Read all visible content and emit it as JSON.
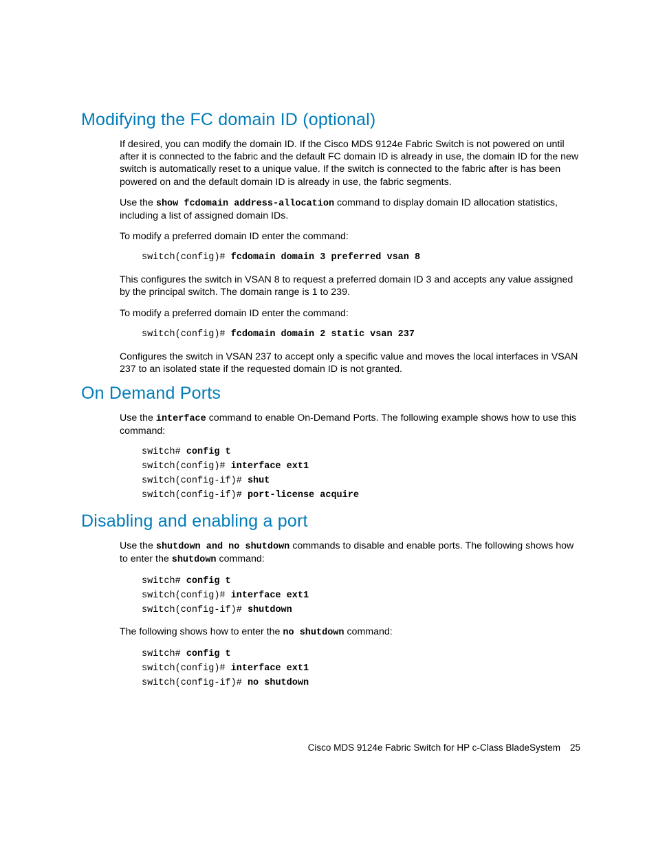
{
  "sections": {
    "s1": {
      "title": "Modifying the FC domain ID (optional)",
      "p1": "If desired, you can modify the domain ID. If the Cisco MDS 9124e Fabric Switch is not powered on until after it is connected to the fabric and the default FC domain ID is already in use, the domain ID for the new switch is automatically reset to a unique value. If the switch is connected to the fabric after is has been powered on and the default domain ID is already in use, the fabric segments.",
      "p2a": "Use the ",
      "p2cmd": "show fcdomain address-allocation",
      "p2b": " command to display domain ID allocation statistics, including a list of assigned domain IDs.",
      "p3": "To modify a preferred domain ID enter the command:",
      "code1_prompt": "switch(config)# ",
      "code1_cmd": "fcdomain domain 3 preferred vsan 8",
      "p4": "This configures the switch in VSAN 8 to request a preferred domain ID 3 and accepts any value assigned by the principal switch. The domain range is 1 to 239.",
      "p5": "To modify a preferred domain ID enter the command:",
      "code2_prompt": "switch(config)# ",
      "code2_cmd": "fcdomain domain 2 static vsan 237",
      "p6": "Configures the switch in VSAN 237 to accept only a specific value and moves the local interfaces in VSAN 237 to an isolated state if the requested domain ID is not granted."
    },
    "s2": {
      "title": "On Demand Ports",
      "p1a": "Use the ",
      "p1cmd": "interface",
      "p1b": " command to enable On-Demand Ports. The following example shows how to use this command:",
      "code_l1p": "switch# ",
      "code_l1c": "config t",
      "code_l2p": "switch(config)# ",
      "code_l2c": "interface ext1",
      "code_l3p": "switch(config-if)# ",
      "code_l3c": "shut",
      "code_l4p": "switch(config-if)# ",
      "code_l4c": "port-license acquire"
    },
    "s3": {
      "title": "Disabling and enabling a port",
      "p1a": "Use the ",
      "p1cmd": "shutdown and no shutdown",
      "p1b": " commands to disable and enable ports. The following shows how to enter the ",
      "p1cmd2": "shutdown",
      "p1c": " command:",
      "codeA_l1p": "switch# ",
      "codeA_l1c": "config t",
      "codeA_l2p": "switch(config)# ",
      "codeA_l2c": "interface ext1",
      "codeA_l3p": "switch(config-if)# ",
      "codeA_l3c": "shutdown",
      "p2a": "The following shows how to enter the ",
      "p2cmd": "no shutdown",
      "p2b": " command:",
      "codeB_l1p": "switch# ",
      "codeB_l1c": "config t",
      "codeB_l2p": "switch(config)# ",
      "codeB_l2c": "interface ext1",
      "codeB_l3p": "switch(config-if)# ",
      "codeB_l3c": "no shutdown"
    }
  },
  "footer": {
    "text": "Cisco MDS 9124e Fabric Switch for HP c-Class BladeSystem",
    "page": "25"
  }
}
